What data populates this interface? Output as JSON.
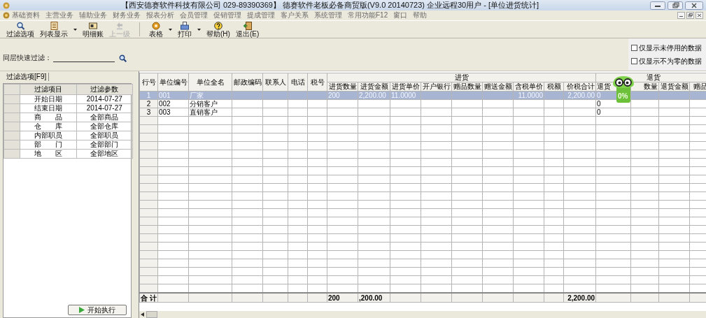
{
  "window": {
    "title": "【西安德赛软件科技有限公司 029-89390369】 德赛软件老板必备商贸版(V9.0 20140723) 企业远程30用户 - [单位进货统计]"
  },
  "menu": [
    "基础资料",
    "主营业务",
    "辅助业务",
    "财务业务",
    "报表分析",
    "会员管理",
    "促销管理",
    "提成管理",
    "客户关系",
    "系统管理",
    "常用功能F12",
    "窗口",
    "帮助"
  ],
  "toolbar": [
    {
      "kind": "search",
      "label": "过滤选项",
      "disabled": false,
      "dropdown": false
    },
    {
      "kind": "list",
      "label": "列表显示",
      "disabled": false,
      "dropdown": true
    },
    {
      "kind": "ledger",
      "label": "明细账",
      "disabled": false,
      "dropdown": false
    },
    {
      "kind": "up",
      "label": "上一级",
      "disabled": true,
      "dropdown": false
    },
    {
      "kind": "table",
      "label": "表格",
      "disabled": false,
      "dropdown": true
    },
    {
      "kind": "print",
      "label": "打印",
      "disabled": false,
      "dropdown": true
    },
    {
      "kind": "help",
      "label": "帮助(H)",
      "disabled": false,
      "dropdown": false
    },
    {
      "kind": "exit",
      "label": "退出(E)",
      "disabled": false,
      "dropdown": false
    }
  ],
  "quick_filter": {
    "label": "同层快速过滤："
  },
  "options": [
    {
      "label": "仅显示未停用的数据",
      "checked": false
    },
    {
      "label": "仅显示不为零的数据",
      "checked": false
    }
  ],
  "filter_panel": {
    "tab": "过滤选项[F9]",
    "columns": [
      "过滤项目",
      "过滤参数"
    ],
    "rows": [
      {
        "item": "开始日期",
        "value": "2014-07-27"
      },
      {
        "item": "结束日期",
        "value": "2014-07-27"
      },
      {
        "item": "商　　品",
        "value": "全部商品"
      },
      {
        "item": "仓　　库",
        "value": "全部仓库"
      },
      {
        "item": "内部职员",
        "value": "全部职员"
      },
      {
        "item": "部　　门",
        "value": "全部部门"
      },
      {
        "item": "地　　区",
        "value": "全部地区"
      }
    ],
    "run_button": "开始执行"
  },
  "table": {
    "columns": [
      {
        "label": "行号"
      },
      {
        "label": "单位编号"
      },
      {
        "label": "单位全名"
      },
      {
        "label": "邮政编码"
      },
      {
        "label": "联系人"
      },
      {
        "label": "电话"
      },
      {
        "label": "税号"
      },
      {
        "group": "进货",
        "children": [
          "进货数量",
          "进货金额",
          "进货单价",
          "开户银行",
          "赠品数量",
          "赠送金额",
          "含税单价",
          "税额",
          "价税合计"
        ]
      },
      {
        "group": "退货",
        "children": [
          "退货",
          "数量",
          "退货金额",
          "赠品"
        ]
      }
    ],
    "rows": [
      {
        "selected": true,
        "no": "1",
        "code": "001",
        "name": "厂家",
        "purchase_qty": "200",
        "purchase_amount": "2,200.00",
        "purchase_price": "11.0000",
        "tax_price": "11.0000",
        "total": "2,200.00",
        "return_qty": "0"
      },
      {
        "selected": false,
        "no": "2",
        "code": "002",
        "name": "分销客户",
        "return_qty": "0"
      },
      {
        "selected": false,
        "no": "3",
        "code": "003",
        "name": "直销客户",
        "return_qty": "0"
      }
    ],
    "total": {
      "no": "合 计",
      "purchase_qty": "200",
      "purchase_amount": ",200.00",
      "total": "2,200.00"
    }
  },
  "mascot": {
    "progress": "0%"
  }
}
